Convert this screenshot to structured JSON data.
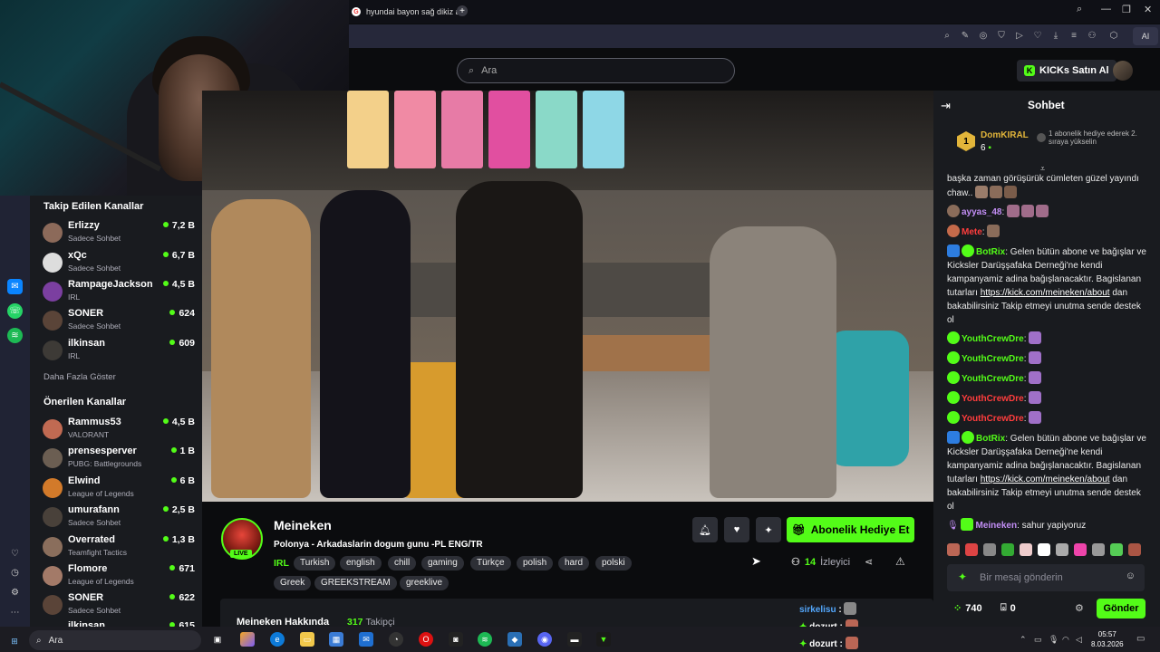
{
  "browser": {
    "tab_title": "hyundai bayon sağ dikiz a",
    "new_tab": "+",
    "ai_button": "AI"
  },
  "header": {
    "search_placeholder": "Ara",
    "kicks_button": "KICKs Satın Al"
  },
  "sidebar": {
    "followed_title": "Takip Edilen Kanallar",
    "followed": [
      {
        "name": "Erlizzy",
        "category": "Sadece Sohbet",
        "viewers": "7,2 B"
      },
      {
        "name": "xQc",
        "category": "Sadece Sohbet",
        "viewers": "6,7 B"
      },
      {
        "name": "RampageJackson",
        "category": "IRL",
        "viewers": "4,5 B"
      },
      {
        "name": "SONER",
        "category": "Sadece Sohbet",
        "viewers": "624"
      },
      {
        "name": "ilkinsan",
        "category": "IRL",
        "viewers": "609"
      }
    ],
    "show_more": "Daha Fazla Göster",
    "recommended_title": "Önerilen Kanallar",
    "recommended": [
      {
        "name": "Rammus53",
        "category": "VALORANT",
        "viewers": "4,5 B"
      },
      {
        "name": "prensesperver",
        "category": "PUBG: Battlegrounds",
        "viewers": "1 B"
      },
      {
        "name": "Elwind",
        "category": "League of Legends",
        "viewers": "6 B"
      },
      {
        "name": "umurafann",
        "category": "Sadece Sohbet",
        "viewers": "2,5 B"
      },
      {
        "name": "Overrated",
        "category": "Teamfight Tactics",
        "viewers": "1,3 B"
      },
      {
        "name": "Flomore",
        "category": "League of Legends",
        "viewers": "671"
      },
      {
        "name": "SONER",
        "category": "Sadece Sohbet",
        "viewers": "622"
      },
      {
        "name": "ilkinsan",
        "category": "",
        "viewers": "615"
      }
    ]
  },
  "stream": {
    "channel": "Meineken",
    "live": "LIVE",
    "title": "Polonya - Arkadaslarin dogum gunu -PL ENG/TR",
    "category": "IRL",
    "tags": [
      "Turkish",
      "english",
      "chill",
      "gaming",
      "Türkçe",
      "polish",
      "hard",
      "polski",
      "Greek",
      "GREEKSTREAM",
      "greeklive"
    ],
    "gift_button": "Abonelik Hediye Et",
    "viewers": "14",
    "viewers_label": "İzleyici",
    "about_title": "Meineken Hakkında",
    "followers": "317",
    "followers_label": "Takipçi"
  },
  "chat": {
    "title": "Sohbet",
    "pinned_user": "DomKIRAL",
    "pinned_count": "6",
    "pinned_rank": "1",
    "pinned_note": "1 abonelik hediye ederek 2. sıraya yükselin",
    "messages": [
      {
        "text": "başka zaman görüşürük cümleten güzel yayındı chaw.."
      },
      {
        "user": "ayyas_48",
        "text": ""
      },
      {
        "user": "Mete",
        "text": ""
      },
      {
        "user": "BotRix",
        "text": "Gelen bütün abone ve bağışlar ve Kicksler Darüşşafaka Derneği'ne kendi kampanyamiz adina bağışlanacaktır. Bagislanan tutarları ",
        "link": "https://kick.com/meineken/about",
        "text2": " dan bakabilirsiniz Takip etmeyi unutma sende destek ol"
      },
      {
        "user": "YouthCrewDre"
      },
      {
        "user": "YouthCrewDre"
      },
      {
        "user": "YouthCrewDre"
      },
      {
        "user": "YouthCrewDre"
      },
      {
        "user": "YouthCrewDre"
      },
      {
        "user": "BotRix",
        "text": "Gelen bütün abone ve bağışlar ve Kicksler Darüşşafaka Derneği'ne kendi kampanyamiz adina bağışlanacaktır. Bagislanan tutarları ",
        "link": "https://kick.com/meineken/about",
        "text2": " dan bakabilirsiniz Takip etmeyi unutma sende destek ol"
      },
      {
        "user": "Meineken",
        "text": "sahur yapiyoruz"
      }
    ],
    "input_placeholder": "Bir mesaj gönderin",
    "points": "740",
    "points2": "0",
    "send_button": "Gönder"
  },
  "overlay_chat": [
    {
      "user": "sirkelisu"
    },
    {
      "user": "dozurt"
    },
    {
      "user": "dozurt"
    }
  ],
  "taskbar": {
    "search_placeholder": "Ara",
    "time": "05:57",
    "date": "8.03.2026"
  },
  "colors": {
    "accent": "#53fc18",
    "chat_bg": "#191b1f",
    "page_bg": "#0b0c0e"
  }
}
